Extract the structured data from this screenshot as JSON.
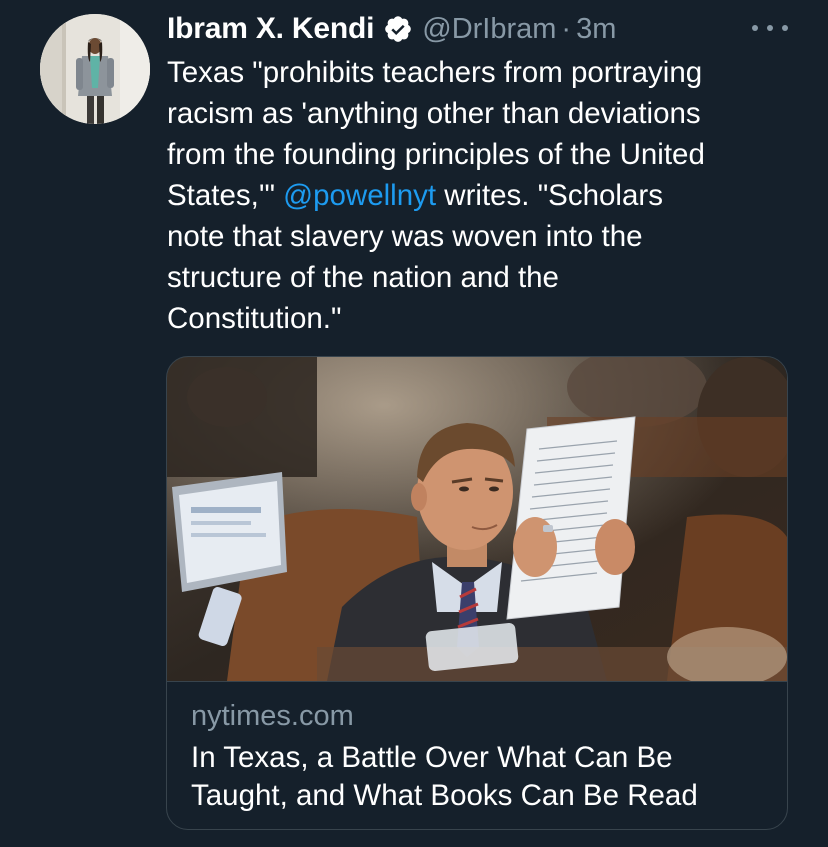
{
  "tweet": {
    "author": {
      "display_name": "Ibram X. Kendi",
      "handle": "@DrIbram",
      "verified": true,
      "avatar_icon": "profile-photo"
    },
    "separator": "·",
    "time": "3m",
    "more_icon": "more-dots-icon",
    "text_lines": [
      {
        "before": "Texas \"prohibits teachers from portraying",
        "mention": "",
        "after": ""
      },
      {
        "before": "racism as 'anything other than deviations",
        "mention": "",
        "after": ""
      },
      {
        "before": "from the founding principles of the United",
        "mention": "",
        "after": ""
      },
      {
        "before": "States,'\" ",
        "mention": "@powellnyt",
        "after": " writes. \"Scholars"
      },
      {
        "before": "note that slavery was woven into the",
        "mention": "",
        "after": ""
      },
      {
        "before": "structure of the nation and the",
        "mention": "",
        "after": ""
      },
      {
        "before": "Constitution.\"",
        "mention": "",
        "after": ""
      }
    ],
    "card": {
      "image_icon": "article-photo",
      "domain": "nytimes.com",
      "title_lines": [
        "In Texas, a Battle Over What Can Be",
        "Taught, and What Books Can Be Read"
      ]
    }
  },
  "colors": {
    "background": "#15202b",
    "text": "#ffffff",
    "secondary": "#8899a6",
    "mention": "#1d9bf0",
    "border": "#38444d",
    "verified_badge": "#ffffff"
  }
}
